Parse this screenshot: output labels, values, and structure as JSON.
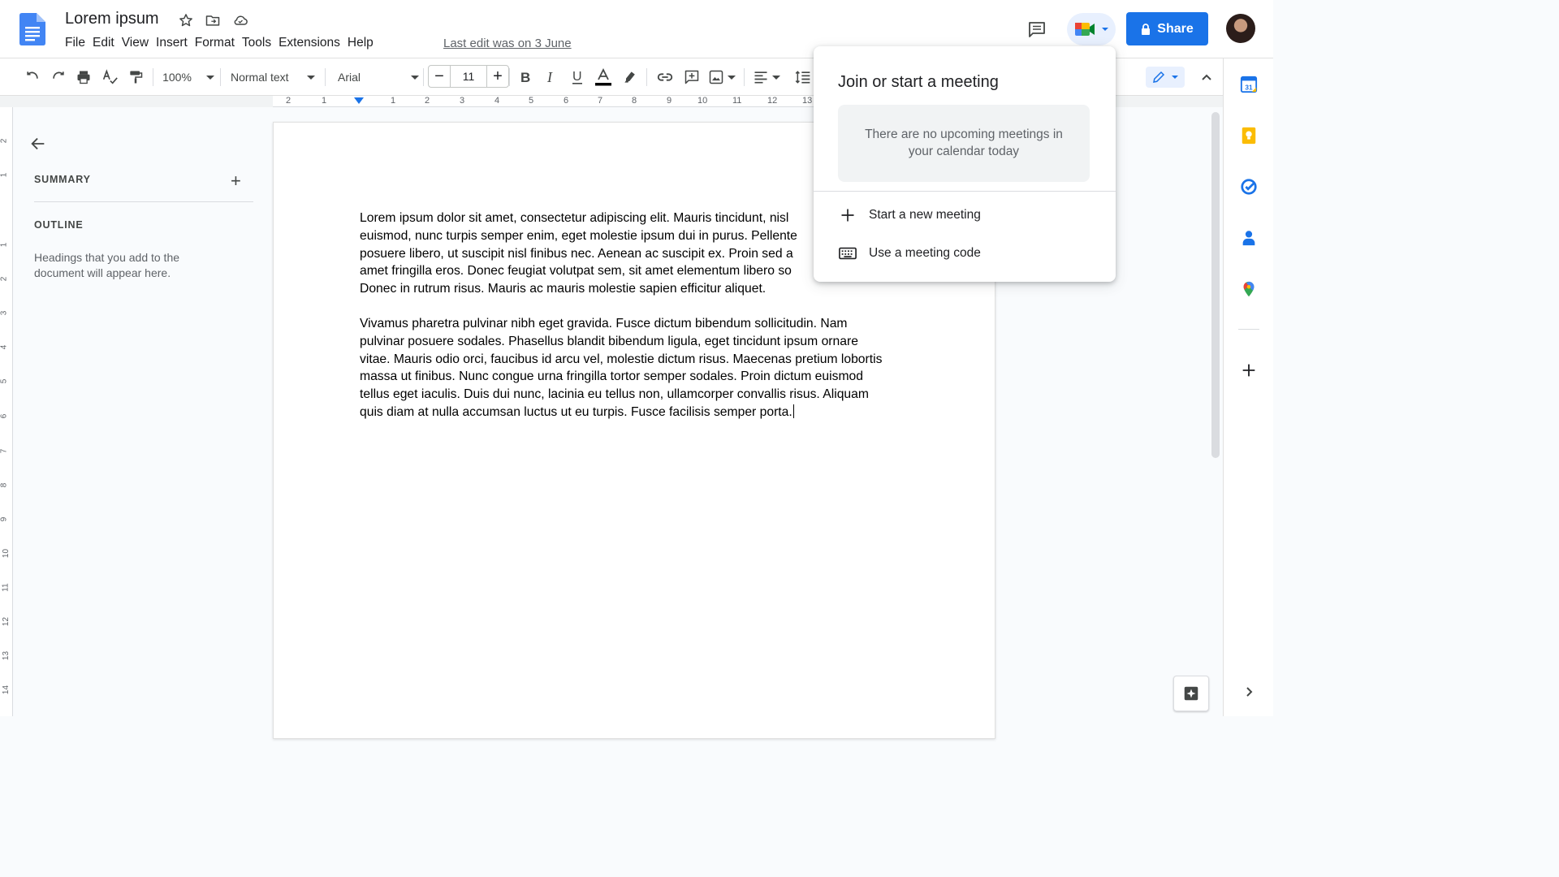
{
  "document": {
    "title": "Lorem ipsum",
    "last_edit": "Last edit was on 3 June"
  },
  "menu": [
    "File",
    "Edit",
    "View",
    "Insert",
    "Format",
    "Tools",
    "Extensions",
    "Help"
  ],
  "header": {
    "share_label": "Share"
  },
  "toolbar": {
    "zoom": "100%",
    "style": "Normal text",
    "font": "Arial",
    "font_size": "11",
    "minus": "−",
    "plus": "+",
    "text_color_accent": "#000000"
  },
  "ruler": {
    "labels": [
      "2",
      "1",
      "1",
      "2",
      "3",
      "4",
      "5",
      "6",
      "7",
      "8",
      "9",
      "10",
      "11",
      "12",
      "13"
    ],
    "vertical_labels": [
      "2",
      "1",
      "1",
      "2",
      "3",
      "4",
      "5",
      "6",
      "7",
      "8",
      "9",
      "10",
      "11",
      "12",
      "13",
      "14"
    ]
  },
  "outline_panel": {
    "summary_label": "SUMMARY",
    "summary_add": "+",
    "outline_label": "OUTLINE",
    "hint": "Headings that you add to the document will appear here."
  },
  "body": {
    "paragraphs": [
      "Lorem ipsum dolor sit amet, consectetur adipiscing elit. Mauris tincidunt, nisl euismod, nunc turpis semper enim, eget molestie ipsum dui in purus. Pellente posuere libero, ut suscipit nisl finibus nec. Aenean ac suscipit ex. Proin sed a amet fringilla eros. Donec feugiat volutpat sem, sit amet elementum libero so Donec in rutrum risus. Mauris ac mauris molestie sapien efficitur aliquet.",
      "Vivamus pharetra pulvinar nibh eget gravida. Fusce dictum bibendum sollicitudin. Nam pulvinar posuere sodales. Phasellus blandit bibendum ligula, eget tincidunt ipsum ornare vitae. Mauris odio orci, faucibus id arcu vel, molestie dictum risus. Maecenas pretium lobortis massa ut finibus. Nunc congue urna fringilla tortor semper sodales. Proin dictum euismod tellus eget iaculis. Duis dui nunc, lacinia eu tellus non, ullamcorper convallis risus. Aliquam quis diam at nulla accumsan luctus ut eu turpis. Fusce facilisis semper porta."
    ],
    "para1_lines": [
      "Lorem ipsum dolor sit amet, consectetur adipiscing elit. Mauris tincidunt, nisl",
      "euismod, nunc turpis semper enim, eget molestie ipsum dui in purus. Pellente",
      "posuere libero, ut suscipit nisl finibus nec. Aenean ac suscipit ex. Proin sed a",
      "amet fringilla eros. Donec feugiat volutpat sem, sit amet elementum libero so",
      "Donec in rutrum risus. Mauris ac mauris molestie sapien efficitur aliquet."
    ],
    "para2_lines": [
      "Vivamus pharetra pulvinar nibh eget gravida. Fusce dictum bibendum sollicitudin. Nam",
      "pulvinar posuere sodales. Phasellus blandit bibendum ligula, eget tincidunt ipsum ornare",
      "vitae. Mauris odio orci, faucibus id arcu vel, molestie dictum risus. Maecenas pretium lobortis",
      "massa ut finibus. Nunc congue urna fringilla tortor semper sodales. Proin dictum euismod",
      "tellus eget iaculis. Duis dui nunc, lacinia eu tellus non, ullamcorper convallis risus. Aliquam",
      "quis diam at nulla accumsan luctus ut eu turpis. Fusce facilisis semper porta."
    ]
  },
  "meet_popup": {
    "title": "Join or start a meeting",
    "empty_message": "There are no upcoming meetings in your calendar today",
    "items": [
      {
        "label": "Start a new meeting",
        "icon": "plus-icon"
      },
      {
        "label": "Use a meeting code",
        "icon": "keyboard-icon"
      }
    ]
  },
  "side_panel": {
    "calendar_day": "31",
    "icons": [
      "calendar-icon",
      "keep-icon",
      "tasks-icon",
      "contacts-icon",
      "maps-icon",
      "add-icon"
    ]
  },
  "colors": {
    "accent": "#1a73e8",
    "docs_blue": "#4285f4"
  }
}
